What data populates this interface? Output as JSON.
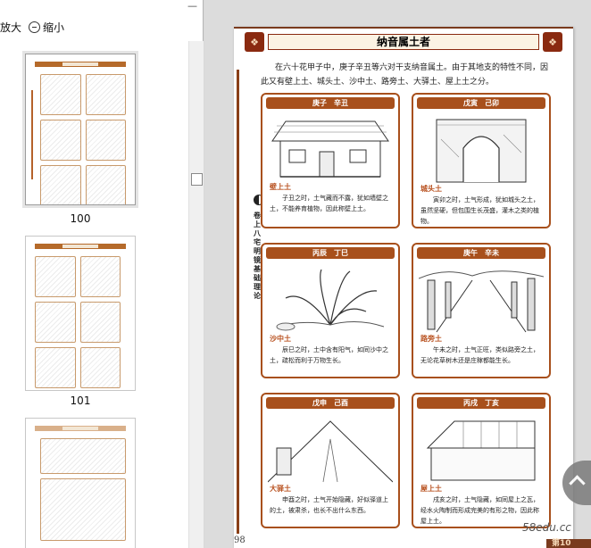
{
  "toolbar": {
    "zoom_in_label": "放大",
    "zoom_out_label": "缩小",
    "close_label": "—"
  },
  "thumbnails": [
    {
      "page_label": "100",
      "selected": true
    },
    {
      "page_label": "101",
      "selected": false
    },
    {
      "page_label": "",
      "selected": false
    }
  ],
  "document": {
    "title": "纳音属土者",
    "intro": "在六十花甲子中，庚子辛丑等六对干支纳音属土。由于其地支的特性不同，因此又有壁上土、城头土、沙中土、路旁土、大驿土、屋上土之分。",
    "side_label": "卷上 八宅明镜基础理论",
    "page_number": "98",
    "cards": [
      {
        "header": "庚子　辛丑",
        "name": "壁上土",
        "text": "子丑之时，土气藏而不露，犹如墙壁之土，不能养育植物，因此称壁上土。"
      },
      {
        "header": "戊寅　己卯",
        "name": "城头土",
        "text": "寅卯之时，土气形成，犹如城头之土，虽然坚硬，但包围生长茂盛，灌木之类的植物。"
      },
      {
        "header": "丙辰　丁巳",
        "name": "沙中土",
        "text": "辰巳之时，土中含有阳气，如同沙中之土，疏松而利于万物生长。"
      },
      {
        "header": "庚午　辛未",
        "name": "路旁土",
        "text": "午未之时，土气正旺，类似路旁之土，无论花草树木还是庄稼都能生长。"
      },
      {
        "header": "戊申　己酉",
        "name": "大驿土",
        "text": "申酉之时，土气开始隐藏，好似驿道上的土，被肃杀，也长不出什么东西。"
      },
      {
        "header": "丙戌　丁亥",
        "name": "屋上土",
        "text": "戌亥之时，土气隐藏，如同屋上之瓦，经水火陶制而形成完美的有形之物，因此称屋上土。"
      }
    ]
  },
  "overlay": {
    "watermark": "58edu.cc",
    "corner_badge": "第10"
  },
  "colors": {
    "accent": "#a8501c",
    "dark_accent": "#8a2a10"
  }
}
